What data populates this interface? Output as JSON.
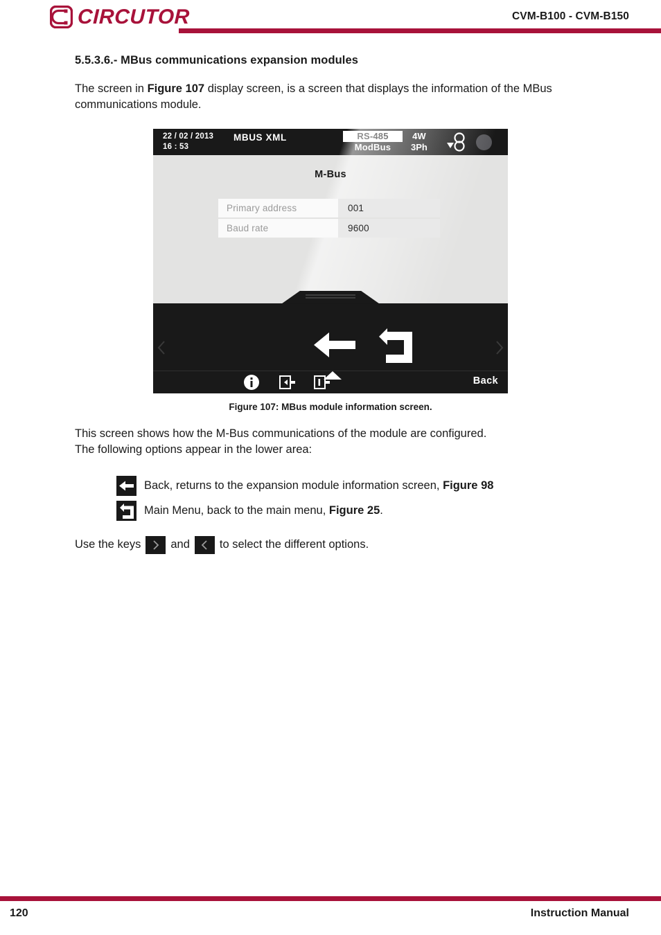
{
  "header": {
    "logo_text": "CIRCUTOR",
    "logo_icon": "circutor-c-logo",
    "model": "CVM-B100 - CVM-B150",
    "rule_color": "#a8123a"
  },
  "document": {
    "section_number": "5.5.3.6.-",
    "section_heading": "5.5.3.6.- MBus communications expansion modules",
    "intro": {
      "part1": "The screen in ",
      "ref": "Figure 107",
      "part2": " display screen, is a screen that displays the information of the MBus communications module."
    },
    "figure_caption": "Figure 107: MBus module information screen.",
    "description_line1": "This screen shows how the M-Bus communications of the module are configured.",
    "description_line2": "The following options appear in the lower area:",
    "options": [
      {
        "icon": "arrow-left-icon",
        "text_before": "Back, returns to the expansion module information screen, ",
        "ref": "Figure 98",
        "text_after": ""
      },
      {
        "icon": "return-arrow-icon",
        "text_before": "Main Menu, back to the main menu, ",
        "ref": "Figure 25",
        "text_after": "."
      }
    ],
    "closing": {
      "part1": "Use the keys ",
      "key_right": "chevron-right-icon",
      "part2": " and ",
      "key_left": "chevron-left-icon",
      "part3": " to select the different options."
    }
  },
  "device_screen": {
    "statusbar": {
      "date": "22 / 02 / 2013",
      "time": "16 : 53",
      "mode": "MBUS  XML",
      "protocol_top": "RS-485",
      "protocol_bottom": "ModBus",
      "wiring_top": "4W",
      "wiring_bottom": "3Ph",
      "phasor_icon": "phasor-diagram-icon",
      "led_icon": "status-led-icon",
      "led_color": "#56565a"
    },
    "title": "M-Bus",
    "table": {
      "rows": [
        {
          "label": "Primary address",
          "value": "001"
        },
        {
          "label": "Baud rate",
          "value": "9600"
        }
      ]
    },
    "navbar": {
      "back_arrow_icon": "arrow-left-icon",
      "return_arrow_icon": "return-arrow-icon",
      "up_icon": "triangle-up-icon",
      "chevron_left_icon": "chevron-left-icon",
      "chevron_right_icon": "chevron-right-icon",
      "info_icon": "info-icon",
      "input_icon": "input-module-icon",
      "output_icon": "output-module-icon",
      "back_label": "Back"
    }
  },
  "footer": {
    "page_number": "120",
    "manual_title": "Instruction Manual",
    "rule_color": "#a8123a"
  }
}
